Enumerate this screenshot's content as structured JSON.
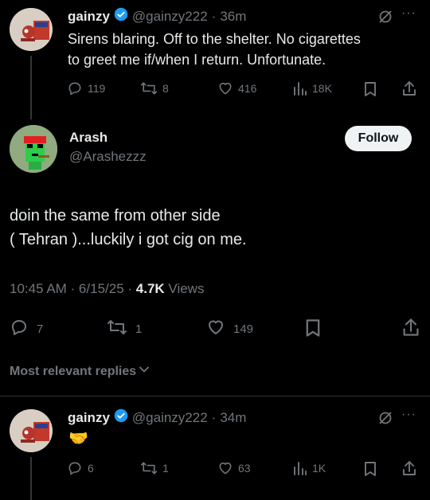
{
  "tweet1": {
    "name": "gainzy",
    "handle": "@gainzy222",
    "time": "36m",
    "text_line1": "Sirens blaring. Off to the shelter. No cigarettes",
    "text_line2": "to greet me if/when I return. Unfortunate.",
    "replies": "119",
    "retweets": "8",
    "likes": "416",
    "views": "18K"
  },
  "main": {
    "name": "Arash",
    "handle": "@Arashezzz",
    "follow_label": "Follow",
    "text_line1": "doin the same from other side",
    "text_line2": "( Tehran )...luckily i got cig on me.",
    "timestamp": "10:45 AM · 6/15/25 · ",
    "views_count": "4.7K",
    "views_label": " Views",
    "replies": "7",
    "retweets": "1",
    "likes": "149"
  },
  "sort_label": "Most relevant replies",
  "tweet2": {
    "name": "gainzy",
    "handle": "@gainzy222",
    "time": "34m",
    "text": "🤝",
    "replies": "6",
    "retweets": "1",
    "likes": "63",
    "views": "1K"
  },
  "colors": {
    "verified": "#1d9bf0",
    "muted": "#71767b",
    "background": "#000000",
    "follow_bg": "#eff3f4"
  }
}
